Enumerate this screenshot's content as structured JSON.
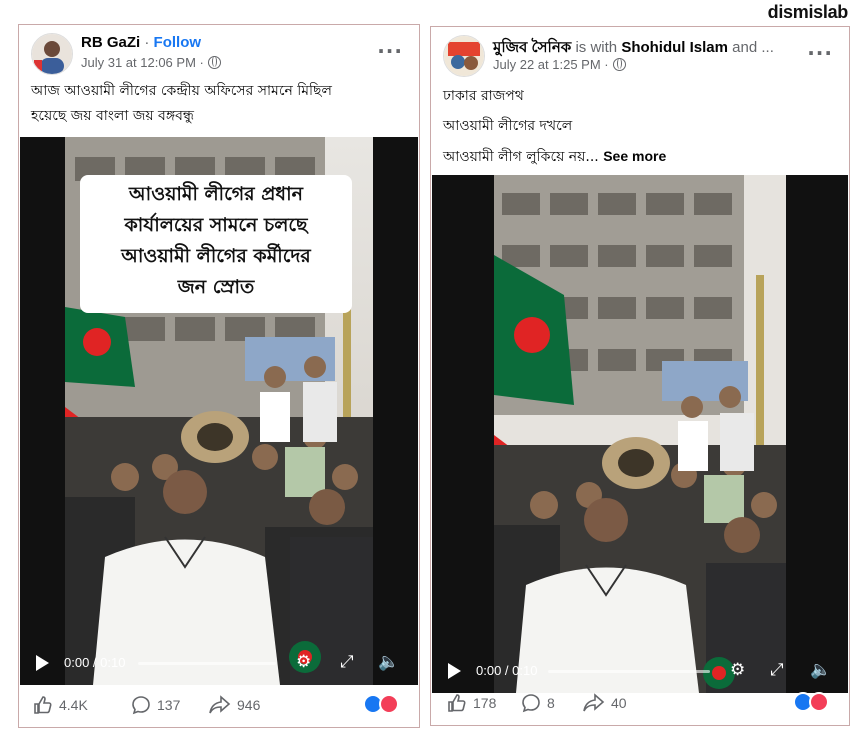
{
  "brand": "dismislab",
  "posts": [
    {
      "author": "RB GaZi",
      "separator": "·",
      "follow": "Follow",
      "time": "July 31 at 12:06 PM ·",
      "text_lines": [
        "আজ আওয়ামী লীগের কেন্দ্রীয় অফিসের সামনে মিছিল",
        "হয়েছে জয় বাংলা জয় বঙ্গবন্ধু"
      ],
      "overlay_lines": [
        "আওয়ামী লীগের প্রধান",
        "কার্যালয়ের সামনে চলছে",
        "আওয়ামী লীগের কর্মীদের",
        "জন স্রোত"
      ],
      "video_time": "0:00 / 0:10",
      "likes": "4.4K",
      "comments": "137",
      "shares": "946",
      "colors": {
        "accent": "#1877f2",
        "flag_green": "#0b6b3a",
        "flag_red": "#e02424"
      }
    },
    {
      "author": "মুজিব সৈনিক",
      "is_with": "is with",
      "tagged": "Shohidul Islam",
      "and_more": "and ...",
      "time": "July 22 at 1:25 PM ·",
      "text_lines": [
        "ঢাকার রাজপথ",
        "আওয়ামী লীগের দখলে"
      ],
      "text_last": "আওয়ামী লীগ লুকিয়ে নয়...",
      "see_more": "See more",
      "video_time": "0:00 / 0:10",
      "likes": "178",
      "comments": "8",
      "shares": "40"
    }
  ],
  "icons": {
    "more": "more-dots-icon",
    "globe": "globe-icon",
    "like": "thumbs-up-icon",
    "comment": "comment-icon",
    "share": "share-icon",
    "settings": "gear-icon",
    "fullscreen": "fullscreen-icon",
    "mute": "mute-icon"
  }
}
